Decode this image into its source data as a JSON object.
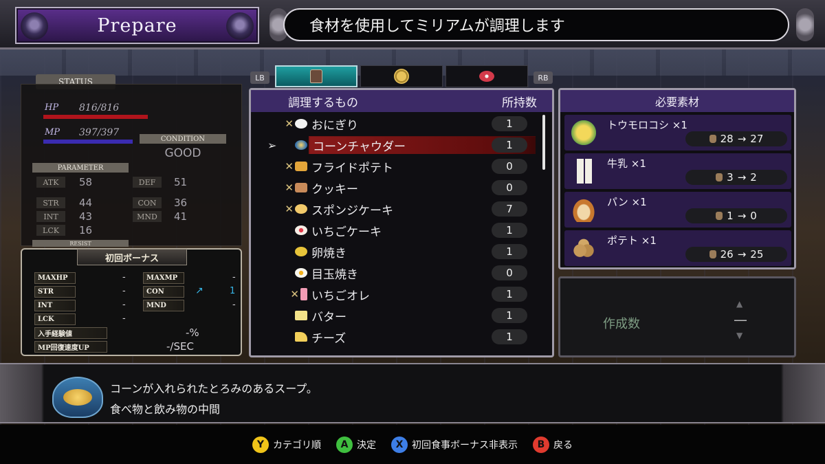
{
  "header": {
    "title": "Prepare",
    "hint": "食材を使用してミリアムが調理します"
  },
  "status": {
    "tab": "STATUS",
    "hp_label": "HP",
    "hp_value": "816/816",
    "mp_label": "MP",
    "mp_value": "397/397",
    "condition_label": "CONDITION",
    "condition_value": "GOOD",
    "parameter_label": "PARAMETER",
    "params": [
      {
        "key": "ATK",
        "value": "58"
      },
      {
        "key": "DEF",
        "value": "51"
      },
      {
        "key": "STR",
        "value": "44"
      },
      {
        "key": "CON",
        "value": "36"
      },
      {
        "key": "INT",
        "value": "43"
      },
      {
        "key": "MND",
        "value": "41"
      },
      {
        "key": "LCK",
        "value": "16"
      }
    ],
    "resist_label": "RESIST"
  },
  "bonus": {
    "title": "初回ボーナス",
    "rows": [
      {
        "key": "MAXHP",
        "value": "-"
      },
      {
        "key": "MAXMP",
        "value": "-"
      },
      {
        "key": "STR",
        "value": "-"
      },
      {
        "key": "CON",
        "value": "1"
      },
      {
        "key": "INT",
        "value": "-"
      },
      {
        "key": "MND",
        "value": "-"
      },
      {
        "key": "LCK",
        "value": "-"
      },
      {
        "key": "入手経験値",
        "value": "-%"
      },
      {
        "key": "MP回復速度UP",
        "value": "-/SEC"
      }
    ]
  },
  "tabs": {
    "lb": "LB",
    "rb": "RB",
    "items": [
      "cooking-pot-icon",
      "plate-icon",
      "meat-icon"
    ]
  },
  "list": {
    "col_name": "調理するもの",
    "col_count": "所持数",
    "items": [
      {
        "name": "おにぎり",
        "count": "1"
      },
      {
        "name": "コーンチャウダー",
        "count": "1"
      },
      {
        "name": "フライドポテト",
        "count": "0"
      },
      {
        "name": "クッキー",
        "count": "0"
      },
      {
        "name": "スポンジケーキ",
        "count": "7"
      },
      {
        "name": "いちごケーキ",
        "count": "1"
      },
      {
        "name": "卵焼き",
        "count": "1"
      },
      {
        "name": "目玉焼き",
        "count": "0"
      },
      {
        "name": "いちごオレ",
        "count": "1"
      },
      {
        "name": "バター",
        "count": "1"
      },
      {
        "name": "チーズ",
        "count": "1"
      }
    ]
  },
  "materials": {
    "title": "必要素材",
    "items": [
      {
        "name": "トウモロコシ ×1",
        "from": "28",
        "to": "27",
        "arrow": "→"
      },
      {
        "name": "牛乳 ×1",
        "from": "3",
        "to": "2",
        "arrow": "→"
      },
      {
        "name": "パン ×1",
        "from": "1",
        "to": "0",
        "arrow": "→"
      },
      {
        "name": "ポテト ×1",
        "from": "26",
        "to": "25",
        "arrow": "→"
      }
    ]
  },
  "quantity": {
    "label": "作成数",
    "value": "—"
  },
  "description": {
    "line1": "コーンが入れられたとろみのあるスープ。",
    "line2": "食べ物と飲み物の中間"
  },
  "guide": [
    {
      "key": "Y",
      "label": "カテゴリ順",
      "color": "#f0c419"
    },
    {
      "key": "A",
      "label": "決定",
      "color": "#3fbf3f"
    },
    {
      "key": "X",
      "label": "初回食事ボーナス非表示",
      "color": "#3d7ee6"
    },
    {
      "key": "B",
      "label": "戻る",
      "color": "#e03b2f"
    }
  ],
  "colors": {
    "accent_purple": "#3c2a66",
    "selected_row": "#8a1a1a",
    "hp_bar": "#b0141c",
    "mp_bar": "#3a2bb0"
  }
}
